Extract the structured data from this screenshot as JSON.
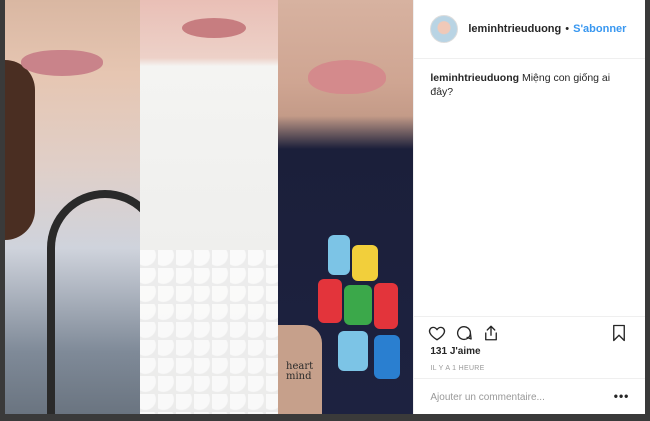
{
  "post": {
    "username": "leminhtrieuduong",
    "separator": "•",
    "follow_label": "S'abonner",
    "caption_user": "leminhtrieuduong",
    "caption_text": "Miệng con giống ai đây?",
    "likes": "131 J'aime",
    "time": "IL Y A 1 HEURE",
    "comment_placeholder": "Ajouter un commentaire...",
    "more_label": "•••",
    "tattoo_text_line1": "heart",
    "tattoo_text_line2": "mind"
  },
  "icons": {
    "like": "heart-icon",
    "comment": "comment-icon",
    "share": "share-icon",
    "save": "bookmark-icon"
  }
}
